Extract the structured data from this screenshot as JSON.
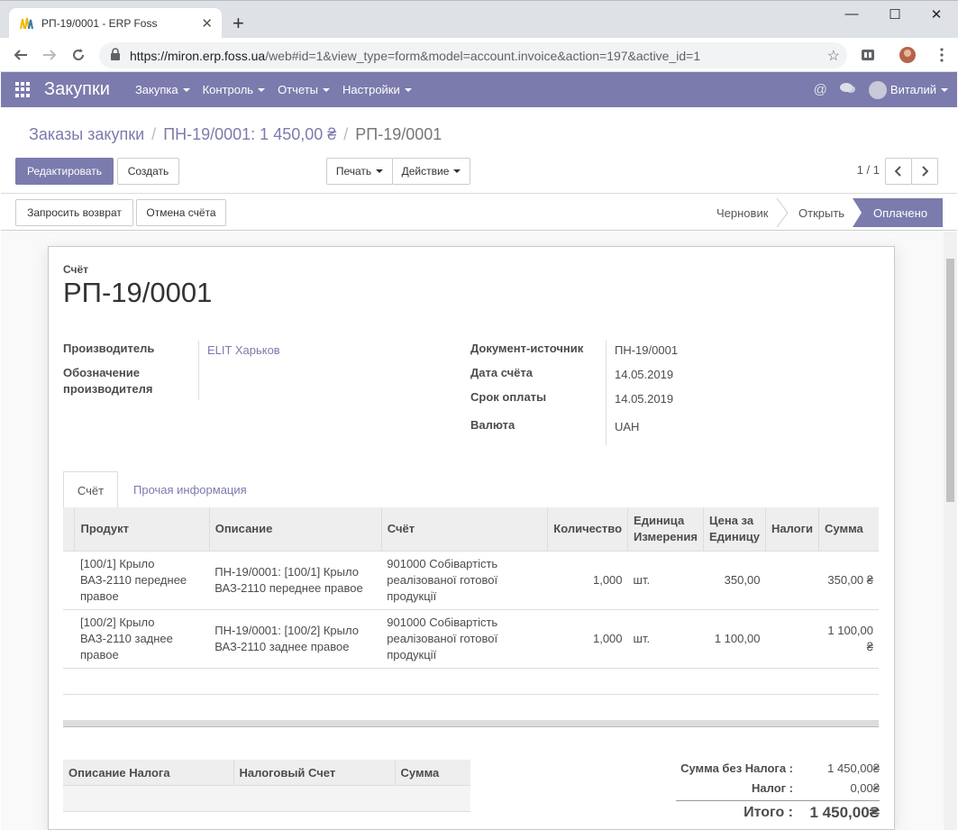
{
  "browser": {
    "tab_title": "РП-19/0001 - ERP Foss",
    "new_tab": "+",
    "url_host": "https://miron.erp.foss.ua",
    "url_path": "/web#id=1&view_type=form&model=account.invoice&action=197&active_id=1"
  },
  "nav": {
    "app_name": "Закупки",
    "menus": [
      "Закупка",
      "Контроль",
      "Отчеты",
      "Настройки"
    ],
    "user": "Виталий"
  },
  "breadcrumb": {
    "items": [
      "Заказы закупки",
      "ПН-19/0001: 1 450,00 ₴"
    ],
    "current": "РП-19/0001"
  },
  "toolbar": {
    "edit": "Редактировать",
    "create": "Создать",
    "print": "Печать",
    "action": "Действие",
    "pager": "1 / 1"
  },
  "statusbar": {
    "refund": "Запросить возврат",
    "cancel": "Отмена счёта",
    "stages": [
      "Черновик",
      "Открыть"
    ],
    "active_stage": "Оплачено"
  },
  "invoice": {
    "doc_type": "Счёт",
    "number": "РП-19/0001",
    "vendor_label": "Производитель",
    "vendor": "ELIT Харьков",
    "vendor_ref_label": "Обозначение производителя",
    "source_label": "Документ-источник",
    "source": "ПН-19/0001",
    "date_label": "Дата счёта",
    "date": "14.05.2019",
    "due_label": "Срок оплаты",
    "due": "14.05.2019",
    "currency_label": "Валюта",
    "currency": "UAH"
  },
  "tabs": [
    "Счёт",
    "Прочая информация"
  ],
  "lines": {
    "headers": [
      "Продукт",
      "Описание",
      "Счёт",
      "Количество",
      "Единица Измерения",
      "Цена за Единицу",
      "Налоги",
      "Сумма"
    ],
    "rows": [
      {
        "product": "[100/1] Крыло ВАЗ-2110 переднее правое",
        "description": "ПН-19/0001: [100/1] Крыло ВАЗ-2110 переднее правое",
        "account": "901000 Собівартість реалізованої готової продукції",
        "qty": "1,000",
        "uom": "шт.",
        "price": "350,00",
        "taxes": "",
        "amount": "350,00 ₴"
      },
      {
        "product": "[100/2] Крыло ВАЗ-2110 заднее правое",
        "description": "ПН-19/0001: [100/2] Крыло ВАЗ-2110 заднее правое",
        "account": "901000 Собівартість реалізованої готової продукції",
        "qty": "1,000",
        "uom": "шт.",
        "price": "1 100,00",
        "taxes": "",
        "amount": "1 100,00 ₴"
      }
    ]
  },
  "tax_table": {
    "headers": [
      "Описание Налога",
      "Налоговый Счет",
      "Сумма"
    ]
  },
  "totals": {
    "untaxed_label": "Сумма без Налога :",
    "untaxed": "1 450,00₴",
    "tax_label": "Налог :",
    "tax": "0,00₴",
    "total_label": "Итого :",
    "total": "1 450,00₴"
  },
  "colors": {
    "primary": "#7c7bad"
  }
}
